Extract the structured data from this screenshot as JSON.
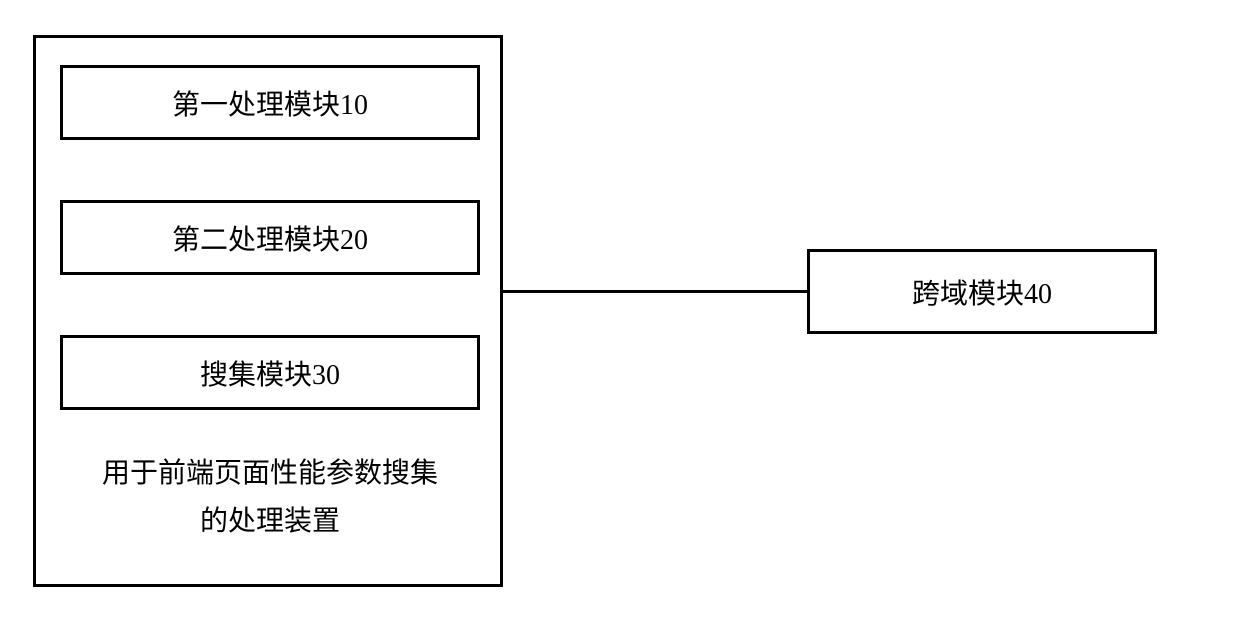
{
  "left": {
    "modules": [
      {
        "label": "第一处理模块10"
      },
      {
        "label": "第二处理模块20"
      },
      {
        "label": "搜集模块30"
      }
    ],
    "caption_line1": "用于前端页面性能参数搜集",
    "caption_line2": "的处理装置"
  },
  "right": {
    "label": "跨域模块40"
  }
}
